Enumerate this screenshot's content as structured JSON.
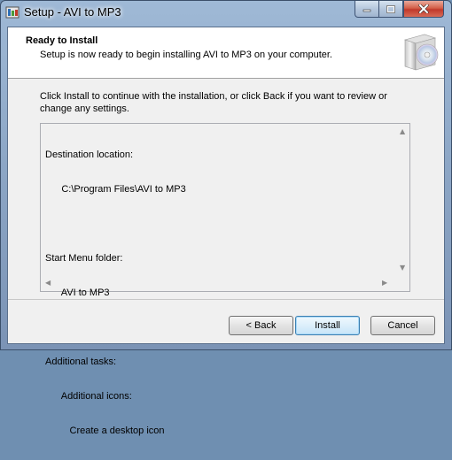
{
  "window": {
    "title": "Setup - AVI to MP3"
  },
  "header": {
    "title": "Ready to Install",
    "subtitle": "Setup is now ready to begin installing AVI to MP3 on your computer."
  },
  "body": {
    "intro": "Click Install to continue with the installation, or click Back if you want to review or change any settings."
  },
  "memo": {
    "lines": [
      "Destination location:",
      "      C:\\Program Files\\AVI to MP3",
      "",
      "Start Menu folder:",
      "      AVI to MP3",
      "",
      "Additional tasks:",
      "      Additional icons:",
      "         Create a desktop icon"
    ]
  },
  "buttons": {
    "back": "< Back",
    "install": "Install",
    "cancel": "Cancel"
  }
}
